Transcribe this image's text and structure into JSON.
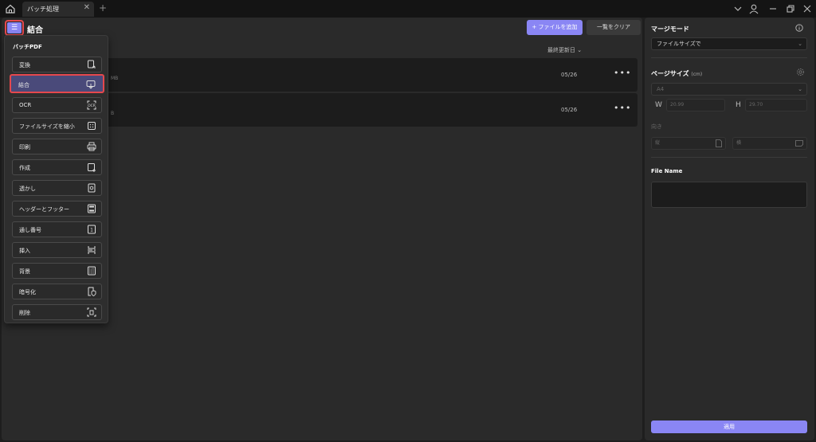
{
  "titlebar": {
    "tab_label": "バッチ処理",
    "tab_close": "✕",
    "tab_add": "+"
  },
  "main": {
    "title": "結合",
    "add_button": "ファイルを追加",
    "add_button_prefix": "+",
    "clear_button": "一覧をクリア",
    "sort_label": "最終更新日",
    "files": [
      {
        "meta": "MB",
        "date": "05/26"
      },
      {
        "meta": "B",
        "date": "05/26"
      }
    ],
    "more": "•••"
  },
  "dropdown": {
    "title": "バッチPDF",
    "items": [
      {
        "label": "変換",
        "icon": "convert-icon"
      },
      {
        "label": "結合",
        "icon": "merge-icon",
        "active": true
      },
      {
        "label": "OCR",
        "icon": "ocr-icon"
      },
      {
        "label": "ファイルサイズを縮小",
        "icon": "compress-icon"
      },
      {
        "label": "印刷",
        "icon": "printer-icon"
      },
      {
        "label": "作成",
        "icon": "create-icon"
      },
      {
        "label": "透かし",
        "icon": "watermark-icon"
      },
      {
        "label": "ヘッダーとフッター",
        "icon": "header-footer-icon"
      },
      {
        "label": "通し番号",
        "icon": "bates-number-icon"
      },
      {
        "label": "挿入",
        "icon": "insert-icon"
      },
      {
        "label": "背景",
        "icon": "background-icon"
      },
      {
        "label": "暗号化",
        "icon": "encrypt-icon"
      },
      {
        "label": "削除",
        "icon": "delete-icon"
      }
    ]
  },
  "right": {
    "merge_mode_title": "マージモード",
    "merge_mode_value": "ファイルサイズで",
    "page_size_title": "ページサイズ",
    "page_size_unit": "(cm)",
    "page_size_value": "A4",
    "w_label": "W",
    "w_value": "20.99",
    "h_label": "H",
    "h_value": "29.70",
    "orientation_label": "向き",
    "portrait_label": "縦",
    "landscape_label": "横",
    "file_name_title": "File Name",
    "apply_button": "適用"
  },
  "colors": {
    "accent": "#8a86f4",
    "highlight_border": "#e5484d",
    "panel": "#2a2a2a",
    "background": "#1e1e1e"
  }
}
